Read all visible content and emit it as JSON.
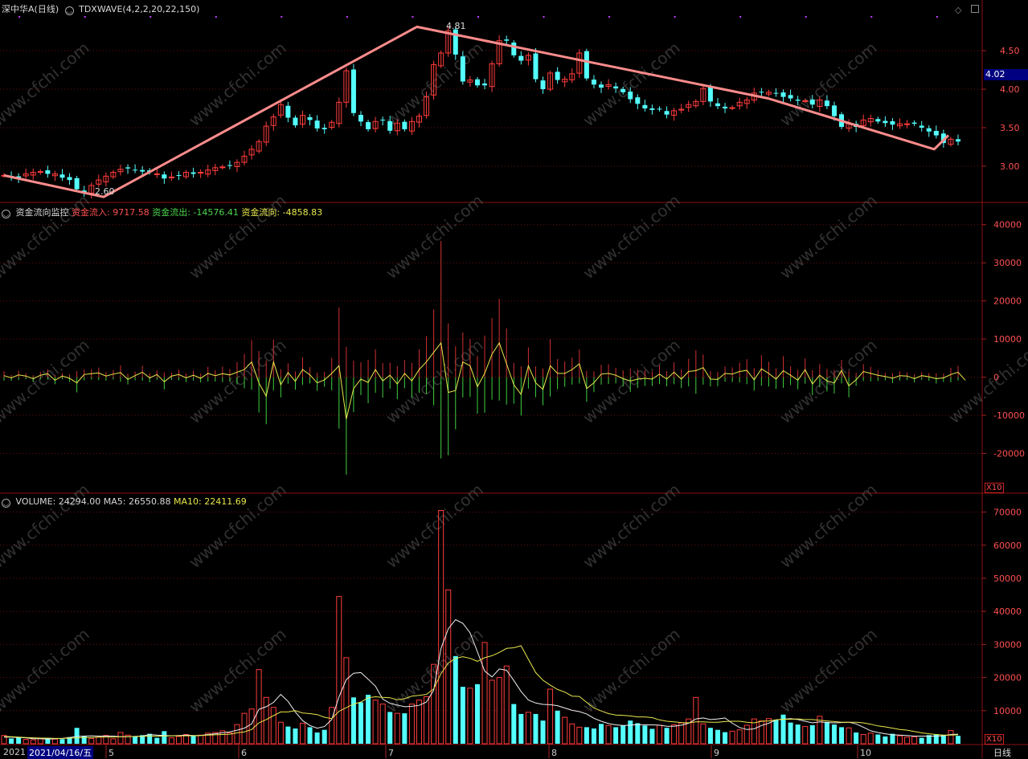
{
  "header": {
    "stock_name": "深中华A(日线)",
    "indicator": "TDXWAVE(4,2,2,20,22,150)"
  },
  "top_right": {
    "current_price_tag": "4.02",
    "colors": {
      "tag_bg": "#000080"
    }
  },
  "panels": {
    "price": {
      "y_ticks": [
        "4.50",
        "4.00",
        "3.50",
        "3.00"
      ],
      "annotations": {
        "low_label": "2.60",
        "high_label": "4.81"
      }
    },
    "flow": {
      "title": "资金流向监控",
      "in_label": "资金流入:",
      "in_value": "9717.58",
      "out_label": "资金流出:",
      "out_value": "-14576.41",
      "net_label": "资金流向:",
      "net_value": "-4858.83",
      "y_ticks": [
        "40000",
        "30000",
        "20000",
        "10000",
        "0",
        "-10000",
        "-20000"
      ],
      "scale": "X10"
    },
    "volume": {
      "title": "VOLUME:",
      "vol_value": "24294.00",
      "ma5_label": "MA5:",
      "ma5_value": "26550.88",
      "ma10_label": "MA10:",
      "ma10_value": "22411.69",
      "y_ticks": [
        "70000",
        "60000",
        "50000",
        "40000",
        "30000",
        "20000",
        "10000"
      ],
      "scale": "X10"
    }
  },
  "x_axis": {
    "year_label": "2021",
    "cursor_date": "2021/04/16/五",
    "month_labels": [
      "5",
      "6",
      "7",
      "8",
      "9",
      "10"
    ],
    "period_label": "日线"
  },
  "watermark": "www.cfchi.com",
  "chart_data": [
    {
      "type": "candlestick",
      "title": "深中华A(日线)",
      "ylim": [
        2.55,
        4.95
      ],
      "wave_points": [
        {
          "x": "2021-04-16",
          "y": 2.88
        },
        {
          "x": "2021-05-07",
          "y": 2.6
        },
        {
          "x": "2021-07-12",
          "y": 4.81
        },
        {
          "x": "2021-09-24",
          "y": 3.88
        },
        {
          "x": "2021-10-29",
          "y": 3.22
        },
        {
          "x": "2021-11-01",
          "y": 3.4
        }
      ],
      "closes": [
        2.88,
        2.86,
        2.85,
        2.9,
        2.92,
        2.93,
        2.9,
        2.9,
        2.85,
        2.82,
        2.7,
        2.65,
        2.75,
        2.82,
        2.87,
        2.92,
        2.96,
        2.97,
        2.95,
        2.93,
        2.92,
        2.9,
        2.84,
        2.86,
        2.88,
        2.92,
        2.9,
        2.92,
        2.95,
        2.98,
        2.99,
        3.01,
        3.05,
        3.13,
        3.22,
        3.32,
        3.52,
        3.64,
        3.8,
        3.63,
        3.53,
        3.66,
        3.6,
        3.49,
        3.48,
        3.57,
        3.83,
        4.24,
        3.69,
        3.58,
        3.48,
        3.58,
        3.6,
        3.46,
        3.56,
        3.48,
        3.58,
        3.65,
        3.9,
        4.32,
        4.47,
        4.76,
        4.45,
        4.1,
        4.12,
        4.05,
        4.05,
        4.33,
        4.63,
        4.63,
        4.44,
        4.37,
        4.44,
        4.13,
        4.0,
        4.21,
        4.12,
        4.13,
        4.2,
        4.47,
        4.14,
        4.06,
        4.02,
        4.06,
        4.01,
        3.96,
        3.87,
        3.81,
        3.75,
        3.73,
        3.74,
        3.67,
        3.72,
        3.74,
        3.8,
        3.84,
        4.01,
        3.84,
        3.78,
        3.75,
        3.76,
        3.83,
        3.86,
        3.95,
        3.96,
        3.96,
        3.95,
        3.9,
        3.88,
        3.85,
        3.85,
        3.8,
        3.86,
        3.78,
        3.65,
        3.51,
        3.55,
        3.51,
        3.6,
        3.62,
        3.58,
        3.56,
        3.54,
        3.55,
        3.55,
        3.55,
        3.5,
        3.45,
        3.4,
        3.3,
        3.35,
        3.32
      ],
      "xlabel": "",
      "ylabel": ""
    },
    {
      "type": "bar",
      "title": "资金流向监控",
      "ylim": [
        -30000,
        45000
      ],
      "net_flow_line": [
        400,
        -200,
        600,
        300,
        -400,
        500,
        900,
        -800,
        300,
        -300,
        -1500,
        700,
        900,
        1100,
        300,
        800,
        1200,
        -600,
        400,
        1300,
        -200,
        700,
        -1200,
        300,
        700,
        -200,
        500,
        -300,
        1000,
        400,
        900,
        600,
        1300,
        2000,
        4000,
        -1500,
        -5000,
        4000,
        -2000,
        1200,
        -1100,
        2000,
        600,
        -1500,
        -700,
        1000,
        3000,
        -11000,
        -3000,
        -500,
        -1400,
        2000,
        -1000,
        500,
        -1800,
        1000,
        -1000,
        2000,
        4000,
        6500,
        9000,
        -4000,
        -3500,
        4000,
        3000,
        -2500,
        1000,
        6000,
        9000,
        3500,
        -2000,
        -4500,
        3000,
        -1500,
        -3200,
        3000,
        1000,
        1000,
        2000,
        3500,
        -3000,
        -1500,
        800,
        1000,
        500,
        -400,
        -1000,
        -500,
        -300,
        -500,
        800,
        -500,
        1300,
        -500,
        1500,
        1700,
        2500,
        -500,
        -600,
        1000,
        800,
        1500,
        1800,
        -700,
        2200,
        1000,
        -500,
        1700,
        500,
        -800,
        2000,
        -1800,
        500,
        -1000,
        -1500,
        1800,
        -2300,
        -700,
        1500,
        1000,
        500,
        200,
        -300,
        400,
        300,
        -400,
        400,
        100,
        -400,
        -200,
        700,
        1300,
        -800
      ],
      "xlabel": "",
      "ylabel": ""
    },
    {
      "type": "bar",
      "title": "VOLUME",
      "ylim": [
        0,
        75000
      ],
      "values": [
        2500,
        1600,
        2000,
        1300,
        1200,
        1500,
        1600,
        1400,
        1400,
        2000,
        4800,
        2400,
        1600,
        2000,
        2500,
        1500,
        3400,
        2600,
        2200,
        2600,
        3000,
        1800,
        3800,
        1800,
        2200,
        2800,
        2400,
        2600,
        3200,
        3400,
        3900,
        3300,
        5800,
        9200,
        10500,
        22400,
        14000,
        11000,
        6500,
        5200,
        4600,
        6200,
        5000,
        3400,
        4200,
        11000,
        44500,
        26000,
        14000,
        12500,
        14800,
        13200,
        12000,
        9600,
        9200,
        9200,
        12000,
        13200,
        14200,
        24000,
        70500,
        46500,
        26500,
        17200,
        16800,
        18000,
        30600,
        19200,
        20000,
        23500,
        12000,
        9000,
        9500,
        9000,
        7000,
        16500,
        10000,
        8000,
        6000,
        5000,
        5000,
        4600,
        6000,
        5500,
        5000,
        5500,
        7000,
        6200,
        5500,
        4500,
        5600,
        4800,
        5700,
        6300,
        7500,
        14000,
        6000,
        4800,
        4200,
        3500,
        3800,
        4200,
        5600,
        7500,
        6900,
        7600,
        7200,
        8800,
        6400,
        5800,
        5200,
        5600,
        8300,
        6600,
        5800,
        5000,
        4800,
        3400,
        2800,
        3200,
        2800,
        2200,
        3000,
        2400,
        2000,
        2100,
        1800,
        2600,
        2900,
        2600,
        4000,
        2400
      ],
      "ma5": [
        2000,
        2000,
        1900,
        1800,
        1500,
        1500,
        1400,
        1500,
        1600,
        1900,
        2200,
        2300,
        2400,
        2300,
        2300,
        2300,
        2100,
        2100,
        2200,
        2300,
        2800,
        2600,
        2500,
        2400,
        2500,
        2600,
        2500,
        2500,
        2800,
        3000,
        3300,
        3600,
        4100,
        4700,
        6000,
        10400,
        11200,
        12500,
        14900,
        12800,
        9600,
        7000,
        5500,
        4700,
        5200,
        7300,
        14200,
        19400,
        21300,
        21500,
        19500,
        17400,
        13500,
        12200,
        11700,
        11200,
        11300,
        11600,
        12600,
        16200,
        28800,
        34700,
        37500,
        36400,
        33500,
        27800,
        22000,
        20200,
        22600,
        22200,
        19100,
        15800,
        13200,
        12300,
        11900,
        11800,
        11500,
        10800,
        10100,
        9700,
        9000,
        7700,
        6800,
        6100,
        5700,
        5500,
        5600,
        5800,
        5700,
        5700,
        5600,
        5300,
        5300,
        5600,
        6200,
        7500,
        7800,
        7300,
        7500,
        7800,
        6200,
        4900,
        4300,
        4500,
        5500,
        6200,
        7200,
        7400,
        7600,
        7300,
        6800,
        6300,
        6600,
        6400,
        6300,
        6400,
        6500,
        6000,
        5000,
        3900,
        3400,
        3000,
        2700,
        2600,
        2500,
        2300,
        2300,
        2300,
        2300,
        2400,
        2800,
        2900
      ],
      "ma10": [
        2200,
        2100,
        2000,
        1900,
        1800,
        1700,
        1700,
        1600,
        1600,
        1700,
        1800,
        1900,
        1900,
        2000,
        2000,
        2000,
        2100,
        2100,
        2200,
        2200,
        2300,
        2300,
        2300,
        2400,
        2400,
        2400,
        2400,
        2500,
        2600,
        2700,
        2800,
        2900,
        3300,
        3600,
        4300,
        6300,
        7300,
        8500,
        9600,
        9600,
        10000,
        9300,
        9100,
        8800,
        8000,
        7600,
        9800,
        10900,
        12000,
        12600,
        13900,
        14200,
        14000,
        13900,
        13300,
        13600,
        14400,
        14600,
        14900,
        16600,
        21200,
        24400,
        25800,
        26300,
        25800,
        24900,
        26000,
        26600,
        27600,
        28800,
        29000,
        29600,
        25500,
        21500,
        19200,
        17700,
        16400,
        15600,
        14400,
        14300,
        12500,
        10800,
        9900,
        9100,
        8700,
        8600,
        8400,
        8100,
        8100,
        7900,
        7200,
        6800,
        6600,
        6400,
        6300,
        6600,
        6600,
        6500,
        6500,
        6700,
        6800,
        6800,
        6500,
        6300,
        6800,
        6900,
        7200,
        7400,
        7400,
        7500,
        7300,
        7300,
        7100,
        6900,
        6700,
        6500,
        6500,
        6500,
        6300,
        5900,
        5400,
        5100,
        4700,
        4300,
        4100,
        3700,
        3300,
        3000,
        2800,
        2600,
        2600,
        2700
      ]
    }
  ]
}
